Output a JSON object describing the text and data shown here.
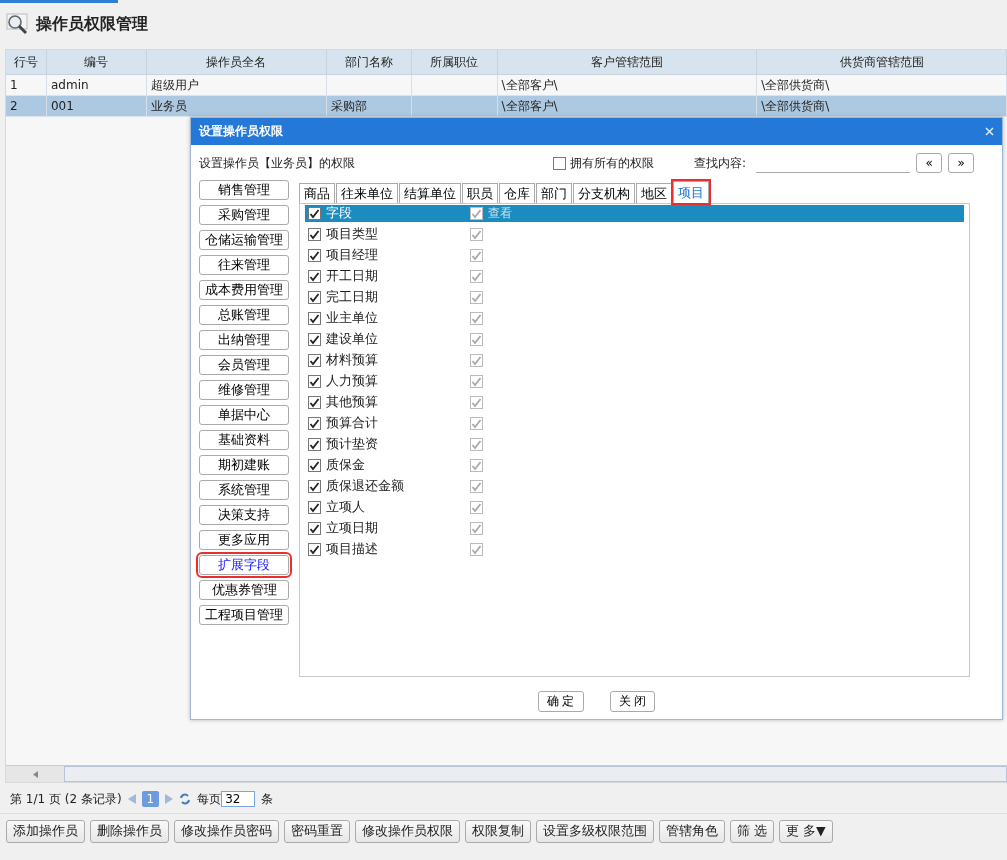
{
  "page_title": "操作员权限管理",
  "table": {
    "columns": [
      "行号",
      "编号",
      "操作员全名",
      "部门名称",
      "所属职位",
      "客户管辖范围",
      "供货商管辖范围"
    ],
    "rows": [
      {
        "cells": [
          "1",
          "admin",
          "超级用户",
          "",
          "",
          "\\全部客户\\",
          "\\全部供货商\\"
        ],
        "selected": false
      },
      {
        "cells": [
          "2",
          "001",
          "业务员",
          "采购部",
          "",
          "\\全部客户\\",
          "\\全部供货商\\"
        ],
        "selected": true
      }
    ]
  },
  "dialog": {
    "title": "设置操作员权限",
    "subtitle": "设置操作员【业务员】的权限",
    "all_permissions": {
      "label": "拥有所有的权限",
      "checked": false
    },
    "search_label": "查找内容:",
    "prev_button": "«",
    "next_button": "»",
    "modules": [
      {
        "label": "销售管理",
        "selected": false
      },
      {
        "label": "采购管理",
        "selected": false
      },
      {
        "label": "仓储运输管理",
        "selected": false
      },
      {
        "label": "往来管理",
        "selected": false
      },
      {
        "label": "成本费用管理",
        "selected": false
      },
      {
        "label": "总账管理",
        "selected": false
      },
      {
        "label": "出纳管理",
        "selected": false
      },
      {
        "label": "会员管理",
        "selected": false
      },
      {
        "label": "维修管理",
        "selected": false
      },
      {
        "label": "单据中心",
        "selected": false
      },
      {
        "label": "基础资料",
        "selected": false
      },
      {
        "label": "期初建账",
        "selected": false
      },
      {
        "label": "系统管理",
        "selected": false
      },
      {
        "label": "决策支持",
        "selected": false
      },
      {
        "label": "更多应用",
        "selected": false
      },
      {
        "label": "扩展字段",
        "selected": true
      },
      {
        "label": "优惠券管理",
        "selected": false
      },
      {
        "label": "工程项目管理",
        "selected": false
      }
    ],
    "tabs": [
      {
        "label": "商品",
        "selected": false
      },
      {
        "label": "往来单位",
        "selected": false
      },
      {
        "label": "结算单位",
        "selected": false
      },
      {
        "label": "职员",
        "selected": false
      },
      {
        "label": "仓库",
        "selected": false
      },
      {
        "label": "部门",
        "selected": false
      },
      {
        "label": "分支机构",
        "selected": false
      },
      {
        "label": "地区",
        "selected": false
      },
      {
        "label": "项目",
        "selected": true
      }
    ],
    "header": {
      "label": "字段",
      "checked": true,
      "view_label": "查看",
      "view_checked": true
    },
    "fields": [
      {
        "label": "项目类型",
        "checked": true,
        "view_checked": true
      },
      {
        "label": "项目经理",
        "checked": true,
        "view_checked": true
      },
      {
        "label": "开工日期",
        "checked": true,
        "view_checked": true
      },
      {
        "label": "完工日期",
        "checked": true,
        "view_checked": true
      },
      {
        "label": "业主单位",
        "checked": true,
        "view_checked": true
      },
      {
        "label": "建设单位",
        "checked": true,
        "view_checked": true
      },
      {
        "label": "材料预算",
        "checked": true,
        "view_checked": true
      },
      {
        "label": "人力预算",
        "checked": true,
        "view_checked": true
      },
      {
        "label": "其他预算",
        "checked": true,
        "view_checked": true
      },
      {
        "label": "预算合计",
        "checked": true,
        "view_checked": true
      },
      {
        "label": "预计垫资",
        "checked": true,
        "view_checked": true
      },
      {
        "label": "质保金",
        "checked": true,
        "view_checked": true
      },
      {
        "label": "质保退还金额",
        "checked": true,
        "view_checked": true
      },
      {
        "label": "立项人",
        "checked": true,
        "view_checked": true
      },
      {
        "label": "立项日期",
        "checked": true,
        "view_checked": true
      },
      {
        "label": "项目描述",
        "checked": true,
        "view_checked": true
      }
    ],
    "buttons": [
      "确 定",
      "关 闭"
    ]
  },
  "pager": {
    "page_info": "第  1/1 页  (2 条记录)",
    "current_page": "1",
    "per_page_label": "每页",
    "per_page_value": "32",
    "unit": "条"
  },
  "actions": [
    "添加操作员",
    "删除操作员",
    "修改操作员密码",
    "密码重置",
    "修改操作员权限",
    "权限复制",
    "设置多级权限范围",
    "管辖角色",
    "筛 选",
    "更 多▼"
  ]
}
